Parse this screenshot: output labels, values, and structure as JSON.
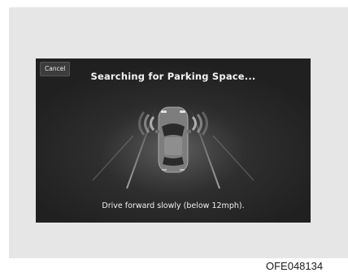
{
  "dialog": {
    "cancel_label": "Cancel",
    "title": "Searching for Parking Space...",
    "instruction": "Drive forward slowly (below 12mph)."
  },
  "figure": {
    "code": "OFE048134"
  },
  "icons": {
    "car": "car-top-view-icon",
    "sensor_waves": "sensor-wave-icon"
  },
  "colors": {
    "screen_background": "#262626",
    "frame_background": "#e6e6e6",
    "text": "#f2f2f2"
  }
}
